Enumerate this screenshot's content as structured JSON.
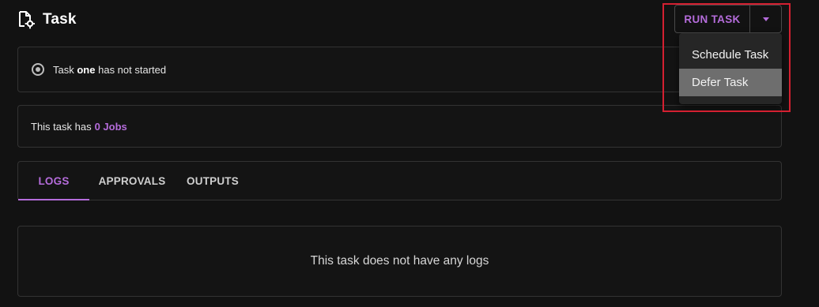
{
  "header": {
    "title": "Task",
    "icon": "file-gear-icon"
  },
  "actions": {
    "run_label": "RUN TASK",
    "toggle_icon": "caret-down-icon",
    "menu": [
      {
        "label": "Schedule Task"
      },
      {
        "label": "Defer Task",
        "hovered": true
      }
    ]
  },
  "status": {
    "icon": "radio-status-icon",
    "prefix": "Task",
    "task_name": "one",
    "suffix": "has not started"
  },
  "jobs": {
    "text": "This task has",
    "link": "0 Jobs"
  },
  "tabs": [
    {
      "label": "LOGS",
      "active": true
    },
    {
      "label": "APPROVALS"
    },
    {
      "label": "OUTPUTS"
    }
  ],
  "logs": {
    "empty_message": "This task does not have any logs"
  },
  "colors": {
    "accent": "#b56cdb",
    "background": "#121212",
    "highlight": "#d42031"
  }
}
